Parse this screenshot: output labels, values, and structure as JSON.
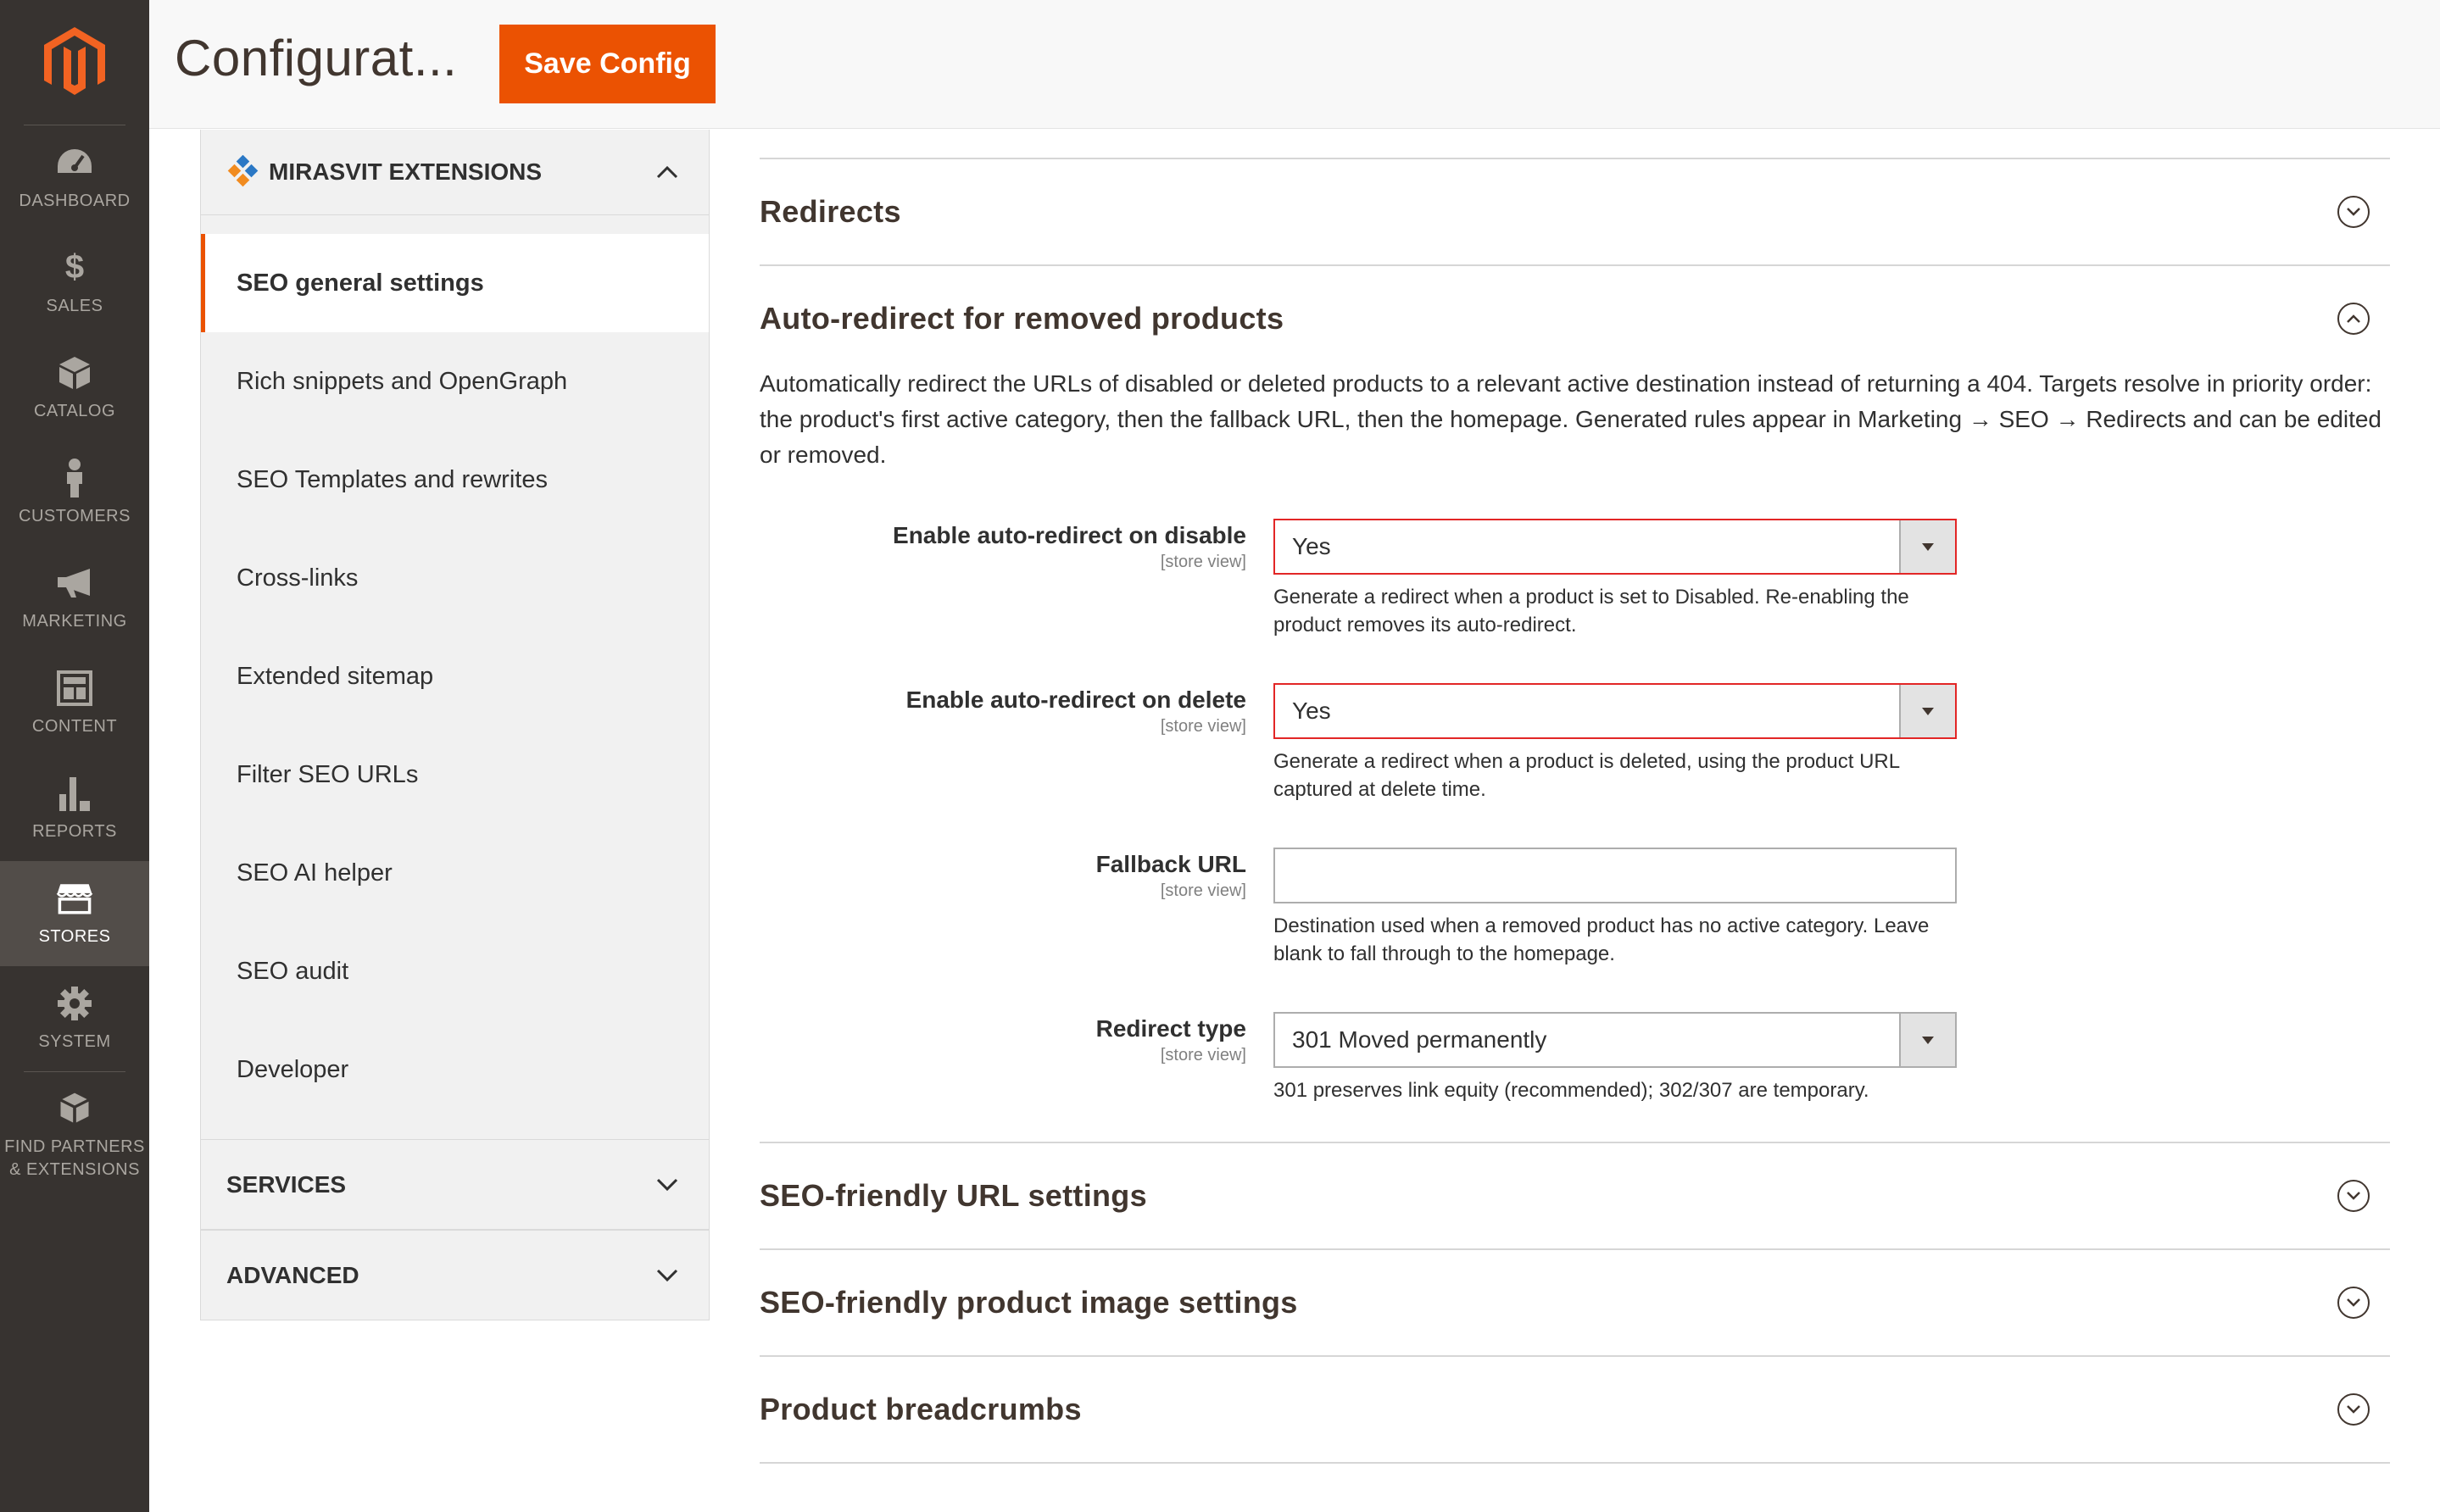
{
  "nav": {
    "items": [
      {
        "label": "DASHBOARD",
        "icon": "dashboard-icon"
      },
      {
        "label": "SALES",
        "icon": "dollar-icon"
      },
      {
        "label": "CATALOG",
        "icon": "cube-icon"
      },
      {
        "label": "CUSTOMERS",
        "icon": "person-icon"
      },
      {
        "label": "MARKETING",
        "icon": "megaphone-icon"
      },
      {
        "label": "CONTENT",
        "icon": "layout-icon"
      },
      {
        "label": "REPORTS",
        "icon": "bar-chart-icon"
      },
      {
        "label": "STORES",
        "icon": "store-icon"
      },
      {
        "label": "SYSTEM",
        "icon": "gear-icon"
      },
      {
        "label": "FIND PARTNERS & EXTENSIONS",
        "icon": "boxes-icon"
      }
    ],
    "active": "STORES"
  },
  "header": {
    "title": "Configurat...",
    "save_label": "Save Config"
  },
  "sidebar": {
    "group_mirasvit": "MIRASVIT EXTENSIONS",
    "items": [
      "SEO general settings",
      "Rich snippets and OpenGraph",
      "SEO Templates and rewrites",
      "Cross-links",
      "Extended sitemap",
      "Filter SEO URLs",
      "SEO AI helper",
      "SEO audit",
      "Developer"
    ],
    "group_services": "SERVICES",
    "group_advanced": "ADVANCED"
  },
  "sections": {
    "redirects": "Redirects",
    "auto_redirect": {
      "title": "Auto-redirect for removed products",
      "description": "Automatically redirect the URLs of disabled or deleted products to a relevant active destination instead of returning a 404. Targets resolve in priority order: the product's first active category, then the fallback URL, then the homepage. Generated rules appear in Marketing → SEO → Redirects and can be edited or removed.",
      "fields": {
        "disable": {
          "label": "Enable auto-redirect on disable",
          "scope": "[store view]",
          "value": "Yes",
          "hint": "Generate a redirect when a product is set to Disabled. Re-enabling the product removes its auto-redirect."
        },
        "delete": {
          "label": "Enable auto-redirect on delete",
          "scope": "[store view]",
          "value": "Yes",
          "hint": "Generate a redirect when a product is deleted, using the product URL captured at delete time."
        },
        "fallback": {
          "label": "Fallback URL",
          "scope": "[store view]",
          "value": "",
          "hint": "Destination used when a removed product has no active category. Leave blank to fall through to the homepage."
        },
        "type": {
          "label": "Redirect type",
          "scope": "[store view]",
          "value": "301 Moved permanently",
          "hint": "301 preserves link equity (recommended); 302/307 are temporary."
        }
      }
    },
    "seo_url": "SEO-friendly URL settings",
    "seo_image": "SEO-friendly product image settings",
    "breadcrumbs": "Product breadcrumbs"
  },
  "colors": {
    "accent": "#eb5202",
    "nav_bg": "#373330",
    "error_border": "#e22626"
  }
}
